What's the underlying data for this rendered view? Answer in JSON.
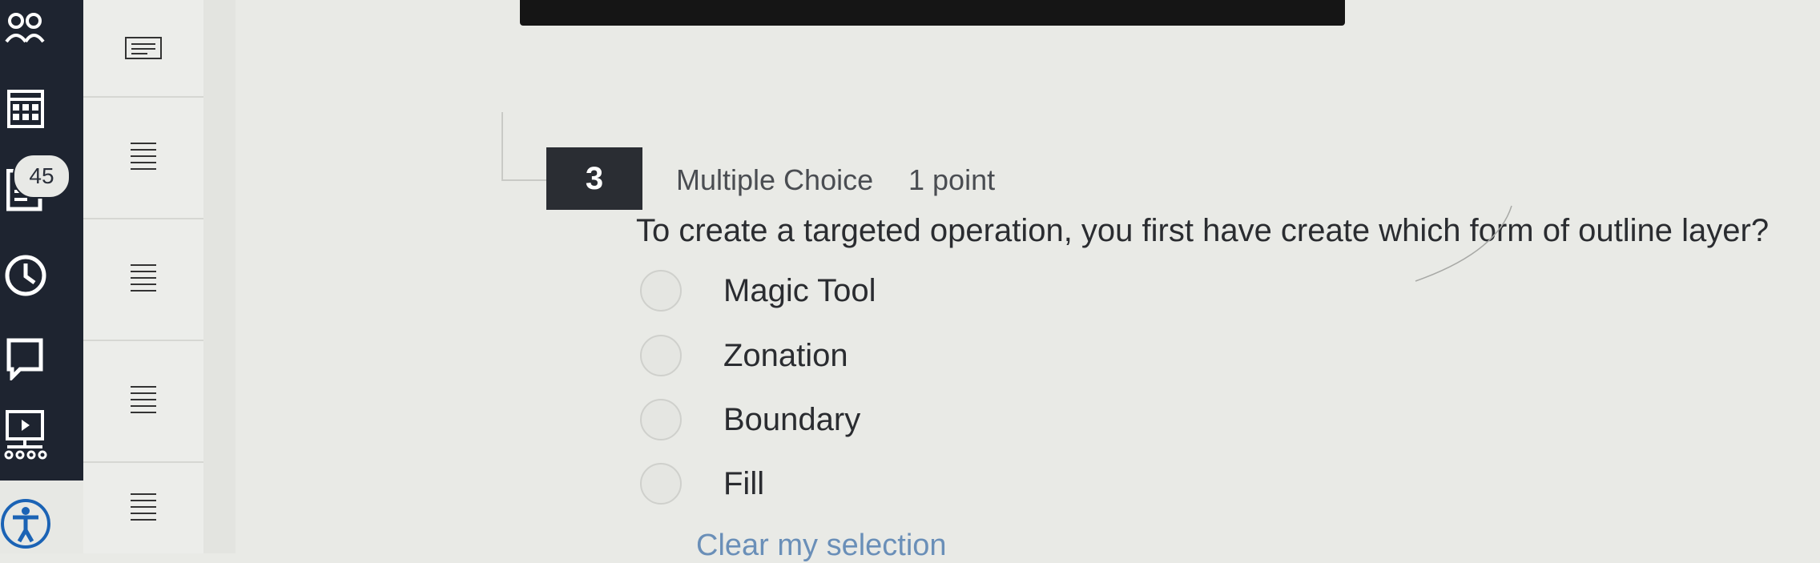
{
  "sidebar": {
    "badge_count": "45",
    "icons": [
      "people-icon",
      "calendar-icon",
      "assignments-icon",
      "history-icon",
      "chat-icon",
      "presentation-icon",
      "accessibility-icon"
    ]
  },
  "question_list": {
    "items": [
      "question-1",
      "question-2",
      "question-3",
      "question-4",
      "question-5"
    ]
  },
  "question": {
    "number": "3",
    "type": "Multiple Choice",
    "points": "1 point",
    "text": "To create a targeted operation, you first have create which form of outline layer?",
    "options": [
      "Magic Tool",
      "Zonation",
      "Boundary",
      "Fill"
    ],
    "clear_label": "Clear my selection"
  }
}
